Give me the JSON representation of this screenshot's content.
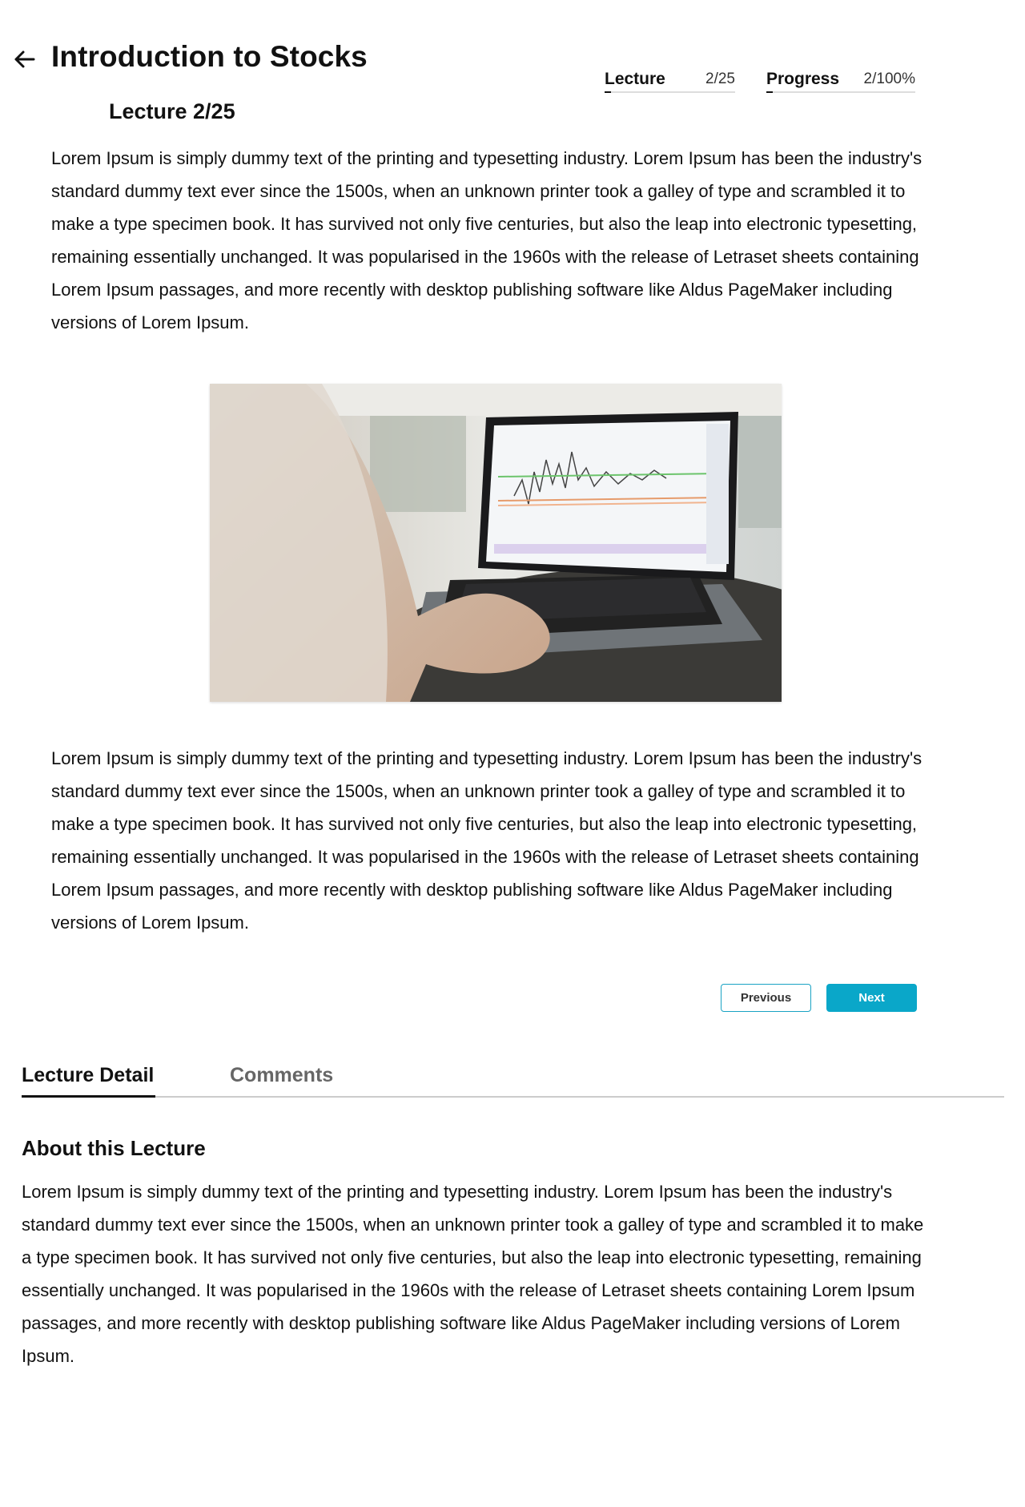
{
  "header": {
    "back_icon": "arrow-left-icon",
    "title": "Introduction to Stocks"
  },
  "meta": {
    "lecture_label": "Lecture",
    "lecture_value": "2/25",
    "progress_label": "Progress",
    "progress_value": "2/100%"
  },
  "lecture": {
    "heading": "Lecture 2/25",
    "paragraph_1": "Lorem Ipsum is simply dummy text of the printing and typesetting industry. Lorem Ipsum has been the industry's standard dummy text ever since the 1500s, when an unknown printer took a galley of type and scrambled it to make a type specimen book. It has survived not only five centuries, but also the leap into electronic typesetting, remaining essentially unchanged. It was popularised in the 1960s with the release of Letraset sheets containing Lorem Ipsum passages, and more recently with desktop publishing software like Aldus PageMaker including versions of Lorem Ipsum.",
    "image": "laptop-stock-chart-photo",
    "paragraph_2": "Lorem Ipsum is simply dummy text of the printing and typesetting industry. Lorem Ipsum has been the industry's standard dummy text ever since the 1500s, when an unknown printer took a galley of type and scrambled it to make a type specimen book. It has survived not only five centuries, but also the leap into electronic typesetting, remaining essentially unchanged. It was popularised in the 1960s with the release of Letraset sheets containing Lorem Ipsum passages, and more recently with desktop publishing software like Aldus PageMaker including versions of Lorem Ipsum."
  },
  "nav": {
    "previous_label": "Previous",
    "next_label": "Next"
  },
  "tabs": [
    {
      "label": "Lecture Detail",
      "active": true
    },
    {
      "label": "Comments",
      "active": false
    }
  ],
  "about": {
    "heading": "About this Lecture",
    "text": "Lorem Ipsum is simply dummy text of the printing and typesetting industry. Lorem Ipsum has been the industry's standard dummy text ever since the 1500s, when an unknown printer took a galley of type and scrambled it to make a type specimen book. It has survived not only five centuries, but also the leap into electronic typesetting, remaining essentially unchanged. It was popularised in the 1960s with the release of Letraset sheets containing Lorem Ipsum passages, and more recently with desktop publishing software like Aldus PageMaker including versions of Lorem Ipsum."
  },
  "colors": {
    "accent": "#0aa7c9",
    "text": "#111111",
    "muted": "#666666",
    "divider": "#cccccc"
  }
}
